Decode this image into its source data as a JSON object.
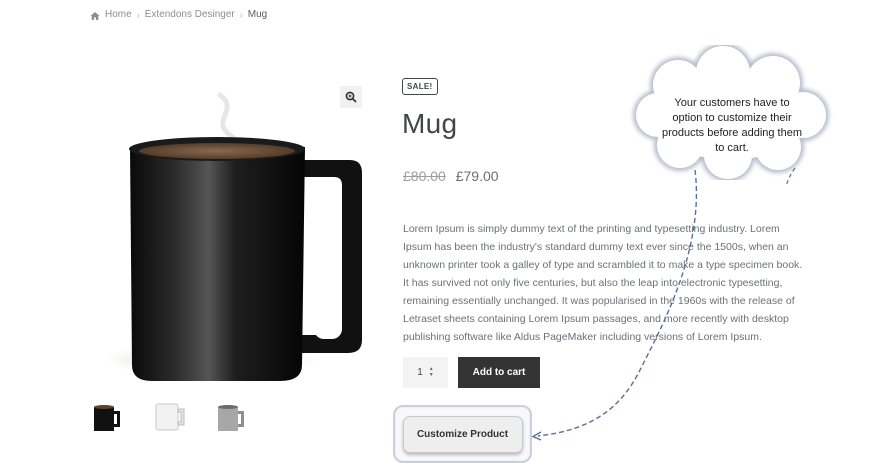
{
  "breadcrumb": {
    "items": [
      "Home",
      "Extendons Desinger",
      "Mug"
    ],
    "separator": "›"
  },
  "product": {
    "badge": "SALE!",
    "title": "Mug",
    "old_price": "£80.00",
    "new_price": "£79.00",
    "description": "Lorem Ipsum is simply dummy text of the printing and typesetting industry. Lorem Ipsum has been the industry's standard dummy text ever since the 1500s, when an unknown printer took a galley of type and scrambled it to make a type specimen book. It has survived not only five centuries, but also the leap into electronic typesetting, remaining essentially unchanged. It was popularised in the 1960s with the release of Letraset sheets containing Lorem Ipsum passages, and more recently with desktop publishing software like Aldus PageMaker including versions of Lorem Ipsum.",
    "quantity": "1",
    "add_to_cart_label": "Add to cart",
    "customize_label": "Customize Product",
    "thumbnails": [
      "black-mug-thumbnail",
      "white-mug-thumbnail",
      "grey-mug-thumbnail"
    ]
  },
  "callout": {
    "text": "Your customers have to option to customize their products before adding them to cart."
  },
  "icons": {
    "home": "home-icon",
    "zoom": "magnifier-zoom-icon"
  },
  "colors": {
    "button_dark": "#333333",
    "text": "#43454b",
    "muted": "#6d7079"
  }
}
